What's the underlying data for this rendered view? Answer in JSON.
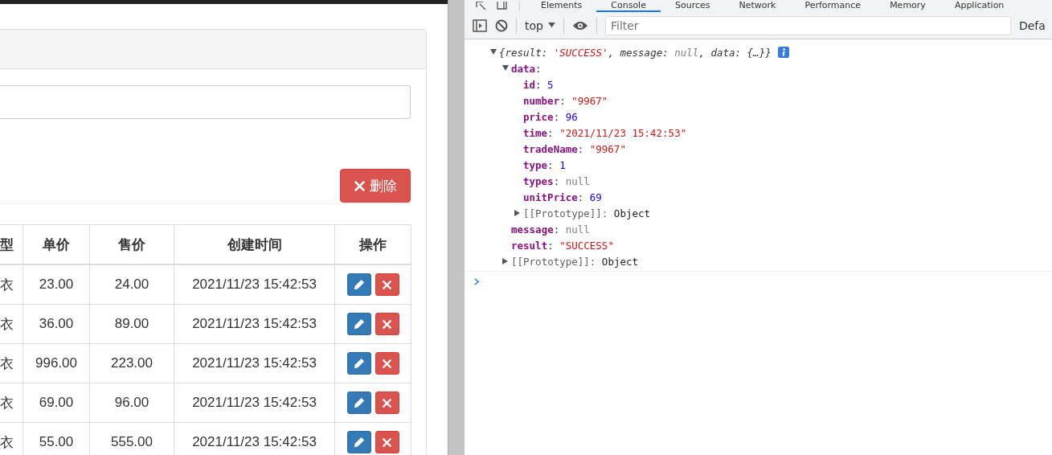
{
  "panel": {
    "delete_button": "删除"
  },
  "table": {
    "columns": [
      "型",
      "单价",
      "售价",
      "创建时间",
      "操作"
    ],
    "rows": [
      {
        "cells": [
          "衣",
          "23.00",
          "24.00",
          "2021/11/23 15:42:53"
        ]
      },
      {
        "cells": [
          "衣",
          "36.00",
          "89.00",
          "2021/11/23 15:42:53"
        ]
      },
      {
        "cells": [
          "衣",
          "996.00",
          "223.00",
          "2021/11/23 15:42:53"
        ]
      },
      {
        "cells": [
          "衣",
          "69.00",
          "96.00",
          "2021/11/23 15:42:53"
        ]
      },
      {
        "cells": [
          "衣",
          "55.00",
          "555.00",
          "2021/11/23 15:42:53"
        ]
      }
    ]
  },
  "devtools": {
    "tabs": [
      {
        "label": "Elements",
        "selected": false
      },
      {
        "label": "Console",
        "selected": true
      },
      {
        "label": "Sources",
        "selected": false
      },
      {
        "label": "Network",
        "selected": false
      },
      {
        "label": "Performance",
        "selected": false
      },
      {
        "label": "Memory",
        "selected": false
      },
      {
        "label": "Application",
        "selected": false
      }
    ],
    "toolbar": {
      "context": "top",
      "filter_placeholder": "Filter",
      "levels": "Defa"
    },
    "console": {
      "expanded": true,
      "summary": [
        {
          "text": "{result: ",
          "kind": "plain"
        },
        {
          "text": "'SUCCESS'",
          "kind": "string"
        },
        {
          "text": ", message: ",
          "kind": "plain"
        },
        {
          "text": "null",
          "kind": "null"
        },
        {
          "text": ", data: {…}}",
          "kind": "plain"
        }
      ],
      "children": [
        {
          "key": "**data**:",
          "kind": "property",
          "expanded": true,
          "children": [
            {
              "key": "**id**:",
              "kind": "property",
              "value": {
                "text": "5",
                "kind": "number"
              }
            },
            {
              "key": "**number**:",
              "kind": "property",
              "value": {
                "text": "\"9967\"",
                "kind": "string"
              }
            },
            {
              "key": "**price**:",
              "kind": "property",
              "value": {
                "text": "96",
                "kind": "number"
              }
            },
            {
              "key": "**time**:",
              "kind": "property",
              "value": {
                "text": "\"2021/11/23 15:42:53\"",
                "kind": "string"
              }
            },
            {
              "key": "**tradeName**:",
              "kind": "property",
              "value": {
                "text": "\"9967\"",
                "kind": "string"
              }
            },
            {
              "key": "**type**:",
              "kind": "property",
              "value": {
                "text": "1",
                "kind": "number"
              }
            },
            {
              "key": "**types**:",
              "kind": "property",
              "value": {
                "text": "null",
                "kind": "null"
              }
            },
            {
              "key": "**unitPrice**:",
              "kind": "property",
              "value": {
                "text": "69",
                "kind": "number"
              }
            },
            {
              "key": "[[Prototype]]:",
              "kind": "internal",
              "value": {
                "text": "Object",
                "kind": "object"
              },
              "expanded": false
            }
          ]
        },
        {
          "key": "**message**:",
          "kind": "property",
          "value": {
            "text": "null",
            "kind": "null"
          }
        },
        {
          "key": "**result**:",
          "kind": "property",
          "value": {
            "text": "\"SUCCESS\"",
            "kind": "string"
          }
        },
        {
          "key": "[[Prototype]]:",
          "kind": "internal",
          "value": {
            "text": "Object",
            "kind": "object"
          },
          "expanded": false
        }
      ]
    }
  }
}
